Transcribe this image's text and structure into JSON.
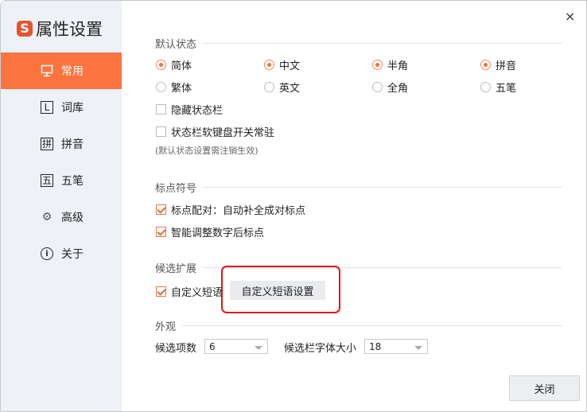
{
  "title": "属性设置",
  "logo_text": "S",
  "sidebar": {
    "items": [
      {
        "label": "常用",
        "icon": "monitor-icon",
        "active": true
      },
      {
        "label": "词库",
        "icon": "lexicon-icon"
      },
      {
        "label": "拼音",
        "icon": "pinyin-icon"
      },
      {
        "label": "五笔",
        "icon": "wubi-icon"
      },
      {
        "label": "高级",
        "icon": "gear-icon"
      },
      {
        "label": "关于",
        "icon": "info-icon"
      }
    ]
  },
  "default_state": {
    "header": "默认状态",
    "radios": [
      {
        "on": "简体",
        "off": "繁体"
      },
      {
        "on": "中文",
        "off": "英文"
      },
      {
        "on": "半角",
        "off": "全角"
      },
      {
        "on": "拼音",
        "off": "五笔"
      }
    ],
    "hide_status_bar": "隐藏状态栏",
    "keyboard_switch": "状态栏软键盘开关常驻",
    "note": "(默认状态设置需注销生效)"
  },
  "punctuation": {
    "header": "标点符号",
    "pairing": "标点配对：自动补全成对标点",
    "smart_adjust": "智能调整数字后标点"
  },
  "candidate_ext": {
    "header": "候选扩展",
    "custom_phrase": "自定义短语",
    "custom_phrase_button": "自定义短语设置"
  },
  "appearance": {
    "header": "外观",
    "count_label": "候选项数",
    "count_value": "6",
    "font_label": "候选栏字体大小",
    "font_value": "18"
  },
  "close_button": "关闭",
  "close_icon": "×"
}
